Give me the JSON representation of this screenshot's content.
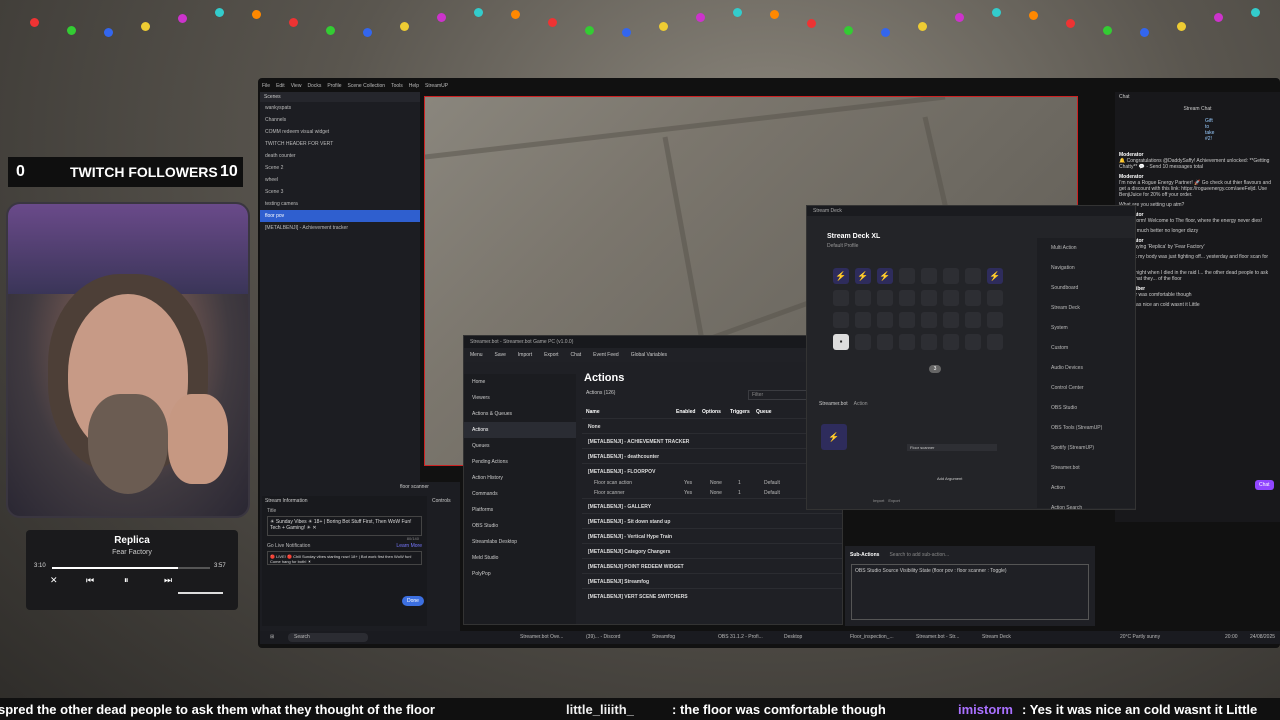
{
  "followers": {
    "count": "0",
    "label": "TWITCH FOLLOWERS",
    "goal": "10"
  },
  "music": {
    "title": "Replica",
    "artist": "Fear Factory",
    "elapsed": "3:10",
    "duration": "3:57",
    "progress": 0.8
  },
  "obs": {
    "menu": [
      "File",
      "Edit",
      "View",
      "Docks",
      "Profile",
      "Scene Collection",
      "Tools",
      "Help",
      "StreamUP"
    ],
    "scenes_header": "Scenes",
    "scenes": [
      "wankyspats",
      "Channels",
      "COMM redeem visual widget",
      "TWITCH HEADER FOR VERT",
      "death counter",
      "Scene 2",
      "wheel",
      "Scene 3",
      "testing camera",
      "floor pov",
      "[METALBENJI] - Achievement tracker"
    ],
    "selected_scene": "floor pov",
    "source_selected": "floor scanner",
    "controls_label": "Controls",
    "stream_info": {
      "header": "Stream Information",
      "title_label": "Title",
      "title_value": "☀ Sunday Vibes ☀ 18+ | Boring Bot Stuff First, Then WoW Fun! Tech + Gaming! ☀ ✕",
      "title_count": "80/140",
      "notif_label": "Go Live Notification",
      "learn_more": "Learn More",
      "notif_value": "🔴 LIVE! 🔴 Chill Sunday vibes starting now! 18+ | Bot work first then WoW fun! Come hang for both! ☀",
      "done": "Done"
    }
  },
  "chat": {
    "tab": "Chat",
    "title": "Stream Chat",
    "gift": "Gift to take #2!",
    "messages": [
      {
        "badge": "Moderator",
        "text": "🔔 Congratulations @DaddySaffy! Achievement unlocked: **Getting Chatty** 💬 - Send 10 messages total"
      },
      {
        "badge": "Moderator",
        "text": "I'm now a Rogue Energy Partner! 🚀 Go check out thier flavours and get a discount with this link: https://rogueenergy.com/aeeFeljd. Use BenjiJuice for 20% off your order."
      },
      {
        "badge": "",
        "text": "What are you setting up atm?"
      },
      {
        "badge": "Moderator",
        "text": "Yo imistorm! Welcome to The floor, where the energy never dies!"
      },
      {
        "badge": "",
        "text": "Feeling much better no longer dizzy"
      },
      {
        "badge": "Moderator",
        "text": "Now playing 'Replica' by 'Fear Factory'"
      },
      {
        "badge": "",
        "text": "Ya think my body was just fighting off... yesterday and floor scan for what..."
      },
      {
        "badge": "",
        "text": "Ya last night when I died in the raid I... the other dead people to ask them what they... of the floor"
      },
      {
        "badge": "Subscriber",
        "text": "the floor was comfortable though"
      },
      {
        "badge": "",
        "text": "Yes it was nice an cold wasnt it Little"
      }
    ],
    "send": "Chat"
  },
  "streamerbot": {
    "window_title": "Streamer.bot - Streamer.bot Game PC (v1.0.0)",
    "toolbar": [
      "Menu",
      "Save",
      "Import",
      "Export",
      "Chat",
      "Event Feed",
      "Global Variables"
    ],
    "nav": [
      "Home",
      "Viewers",
      "Actions & Queues",
      "Actions",
      "Queues",
      "Pending Actions",
      "Action History",
      "Commands",
      "Platforms",
      "OBS Studio",
      "Streamlabs Desktop",
      "Meld Studio",
      "PolyPop"
    ],
    "nav_active": "Actions",
    "section_title": "Actions",
    "actions_count": "Actions (126)",
    "filter_placeholder": "Filter",
    "columns": [
      "Name",
      "Enabled",
      "Options",
      "Triggers",
      "Queue"
    ],
    "groups": [
      "None",
      "[METALBENJI] - ACHIEVEMENT TRACKER",
      "[METALBENJI] - deathcounter",
      "[METALBENJI] - FLOORPOV"
    ],
    "floor_rows": [
      {
        "name": "Floor scan action",
        "enabled": "Yes",
        "options": "None",
        "triggers": "1",
        "queue": "Default"
      },
      {
        "name": "Floor scanner",
        "enabled": "Yes",
        "options": "None",
        "triggers": "1",
        "queue": "Default"
      }
    ],
    "groups_after": [
      "[METALBENJI] - GALLERY",
      "[METALBENJI] - Sit down stand up",
      "[METALBENJI] - Vertical Hype Train",
      "[METALBENJI] Category Changers",
      "[METALBENJI] POINT REDEEM WIDGET",
      "[METALBENJI] Streamfog",
      "[METALBENJI] VERT SCENE SWITCHERS"
    ],
    "subactions_label": "Sub-Actions",
    "subactions_placeholder": "Search to add sub-action...",
    "subaction_item": "OBS Studio Source Visibility State (floor pov : floor scanner : Toggle)"
  },
  "streamdeck": {
    "window_title": "Stream Deck",
    "device": "Stream Deck XL",
    "profile": "Default Profile",
    "page": "3",
    "plugin": "Streamer.bot",
    "plugin_tab": "Action",
    "action_label": "Floor scanner",
    "add_argument": "Add Argument",
    "import": "Import",
    "export": "Export",
    "categories": [
      "Multi Action",
      "Navigation",
      "Soundboard",
      "Stream Deck",
      "System",
      "Custom",
      "Audio Devices",
      "Control Center",
      "OBS Studio",
      "OBS Tools (StreamUP)",
      "Spotify (StreamUP)",
      "Streamer.bot",
      "Action",
      "Action Search"
    ]
  },
  "taskbar": {
    "search": "Search",
    "items": [
      "Streamer.bot Ove...",
      "(39)... - Discord",
      "Streamfog",
      "OBS 31.1.2 - Profi...",
      "Desktop",
      "Floor_inspection_...",
      "Streamer.bot - Str...",
      "Stream Deck"
    ],
    "weather": "20°C Partly sunny",
    "time": "20:00",
    "date": "24/08/2025"
  },
  "ticker": {
    "lead": "spred the other dead people to ask them what they thought of the floor",
    "user1": "little_liiith_",
    "msg1": ": the floor was comfortable though",
    "user2": "imistorm",
    "msg2": ": Yes it was nice an cold wasnt it Little"
  }
}
